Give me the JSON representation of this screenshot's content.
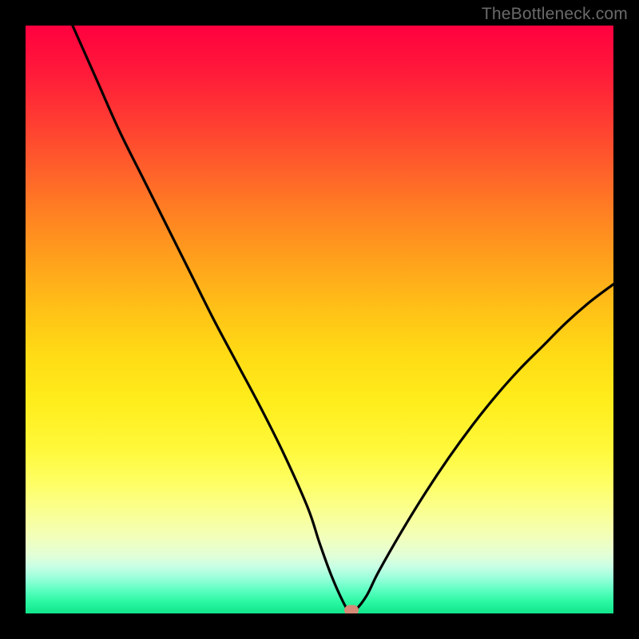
{
  "watermark": "TheBottleneck.com",
  "colors": {
    "curve": "#000000",
    "marker": "#d58b77",
    "frame": "#000000"
  },
  "chart_data": {
    "type": "line",
    "title": "",
    "xlabel": "",
    "ylabel": "",
    "xlim": [
      0,
      100
    ],
    "ylim": [
      0,
      100
    ],
    "grid": false,
    "legend": false,
    "series": [
      {
        "name": "bottleneck-curve",
        "x": [
          8,
          12,
          16,
          20,
          24,
          28,
          32,
          36,
          40,
          44,
          48,
          50,
          52,
          54,
          55,
          56,
          58,
          60,
          64,
          68,
          72,
          76,
          80,
          84,
          88,
          92,
          96,
          100
        ],
        "y": [
          100,
          91,
          82,
          74,
          66,
          58,
          50,
          42.5,
          35,
          27,
          18,
          12,
          6.5,
          2,
          0.5,
          0.5,
          3,
          7,
          14,
          20.5,
          26.5,
          32,
          37,
          41.5,
          45.5,
          49.5,
          53,
          56
        ]
      }
    ],
    "marker": {
      "x": 55.5,
      "y": 0.5
    },
    "gradient_stops": [
      {
        "pct": 0,
        "color": "#ff003f"
      },
      {
        "pct": 24,
        "color": "#ff5e2b"
      },
      {
        "pct": 48,
        "color": "#ffc017"
      },
      {
        "pct": 72,
        "color": "#fff83a"
      },
      {
        "pct": 90,
        "color": "#e3ffd6"
      },
      {
        "pct": 100,
        "color": "#12e58c"
      }
    ]
  }
}
